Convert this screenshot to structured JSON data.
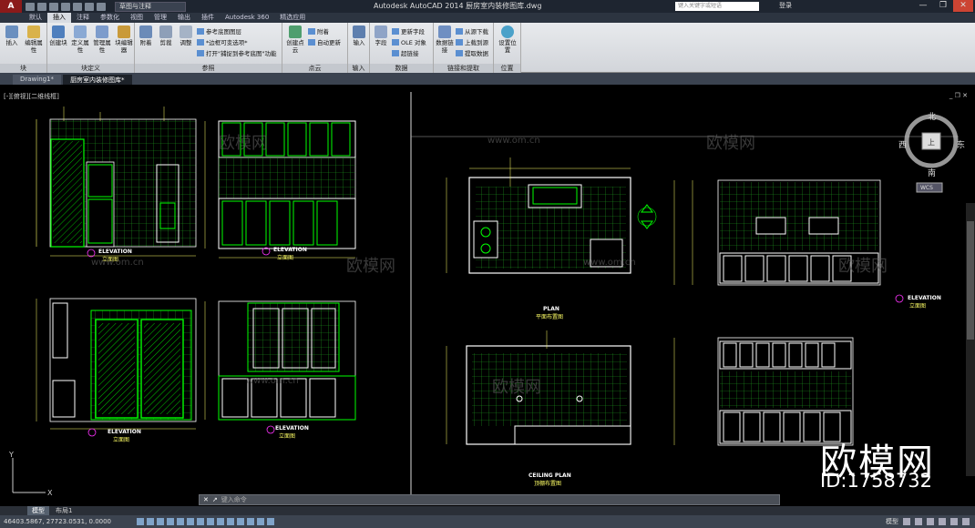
{
  "app": {
    "logo": "A",
    "workspace": "草图与注释",
    "title": "Autodesk AutoCAD 2014    厨房室内装修图库.dwg",
    "search_placeholder": "键入关键字或短语",
    "login": "登录",
    "window_controls": [
      "—",
      "❐",
      "✕"
    ]
  },
  "ribbon_tabs": [
    "默认",
    "插入",
    "注释",
    "参数化",
    "视图",
    "管理",
    "输出",
    "插件",
    "Autodesk 360",
    "精选应用"
  ],
  "ribbon_active_tab": "插入",
  "panels": [
    {
      "title": "块",
      "buttons": [
        {
          "label": "插入",
          "icon": "insert-block-icon"
        },
        {
          "label": "编辑属性",
          "icon": "edit-attribute-icon"
        }
      ]
    },
    {
      "title": "块定义",
      "buttons": [
        {
          "label": "创建块",
          "icon": "create-block-icon"
        },
        {
          "label": "定义属性",
          "icon": "define-attribute-icon"
        },
        {
          "label": "管理属性",
          "icon": "manage-attribute-icon"
        },
        {
          "label": "块编辑器",
          "icon": "block-editor-icon"
        }
      ]
    },
    {
      "title": "参照",
      "buttons": [
        {
          "label": "附着",
          "icon": "attach-icon"
        },
        {
          "label": "剪裁",
          "icon": "clip-icon"
        },
        {
          "label": "调整",
          "icon": "adjust-icon"
        }
      ],
      "rows": [
        "参考底图图层",
        "*边框可变选项*",
        "打开\"捕捉到参考底图\"功能"
      ]
    },
    {
      "title": "点云",
      "buttons": [
        {
          "label": "创建点云",
          "icon": "create-point-cloud-icon"
        }
      ],
      "rows": [
        "附着",
        "自动更新"
      ]
    },
    {
      "title": "输入",
      "buttons": [
        {
          "label": "输入",
          "icon": "import-icon"
        }
      ]
    },
    {
      "title": "数据",
      "buttons": [
        {
          "label": "字段",
          "icon": "field-icon"
        }
      ],
      "rows": [
        "更新字段",
        "OLE 对象",
        "超链接"
      ]
    },
    {
      "title": "链接和提取",
      "buttons": [
        {
          "label": "数据链接",
          "icon": "data-link-icon"
        }
      ],
      "rows": [
        "从源下载",
        "上载到源",
        "提取数据"
      ]
    },
    {
      "title": "位置",
      "buttons": [
        {
          "label": "设置位置",
          "icon": "set-location-icon"
        }
      ]
    }
  ],
  "doc_tabs": [
    "Drawing1*",
    "厨房室内装修图库*"
  ],
  "doc_tab_active": 1,
  "viewport_label": "[-][俯视][二维线框]",
  "viewport_controls": "_ ❐ ✕",
  "drawing": {
    "elevation_label": "ELEVATION",
    "elevation_cn": "立面图",
    "plan_label": "PLAN",
    "plan_cn": "平面布置图",
    "ceiling_label": "CEILING PLAN",
    "ceiling_cn": "顶棚布置图",
    "compass": {
      "n": "北",
      "s": "南",
      "w": "西",
      "e": "东",
      "center": "上"
    },
    "wcs": "WCS",
    "ucs_y": "Y",
    "ucs_x": "X"
  },
  "watermark": {
    "brand": "欧模网",
    "site": "www.om.cn",
    "big": "欧模网",
    "id": "ID:1758732"
  },
  "command": {
    "prompt": "键入命令",
    "icons": [
      "✕",
      "↗"
    ]
  },
  "layout_tabs": [
    "模型",
    "布局1"
  ],
  "layout_active": 0,
  "status": {
    "coords": "46403.5867, 27723.0531, 0.0000",
    "right": "模型"
  }
}
